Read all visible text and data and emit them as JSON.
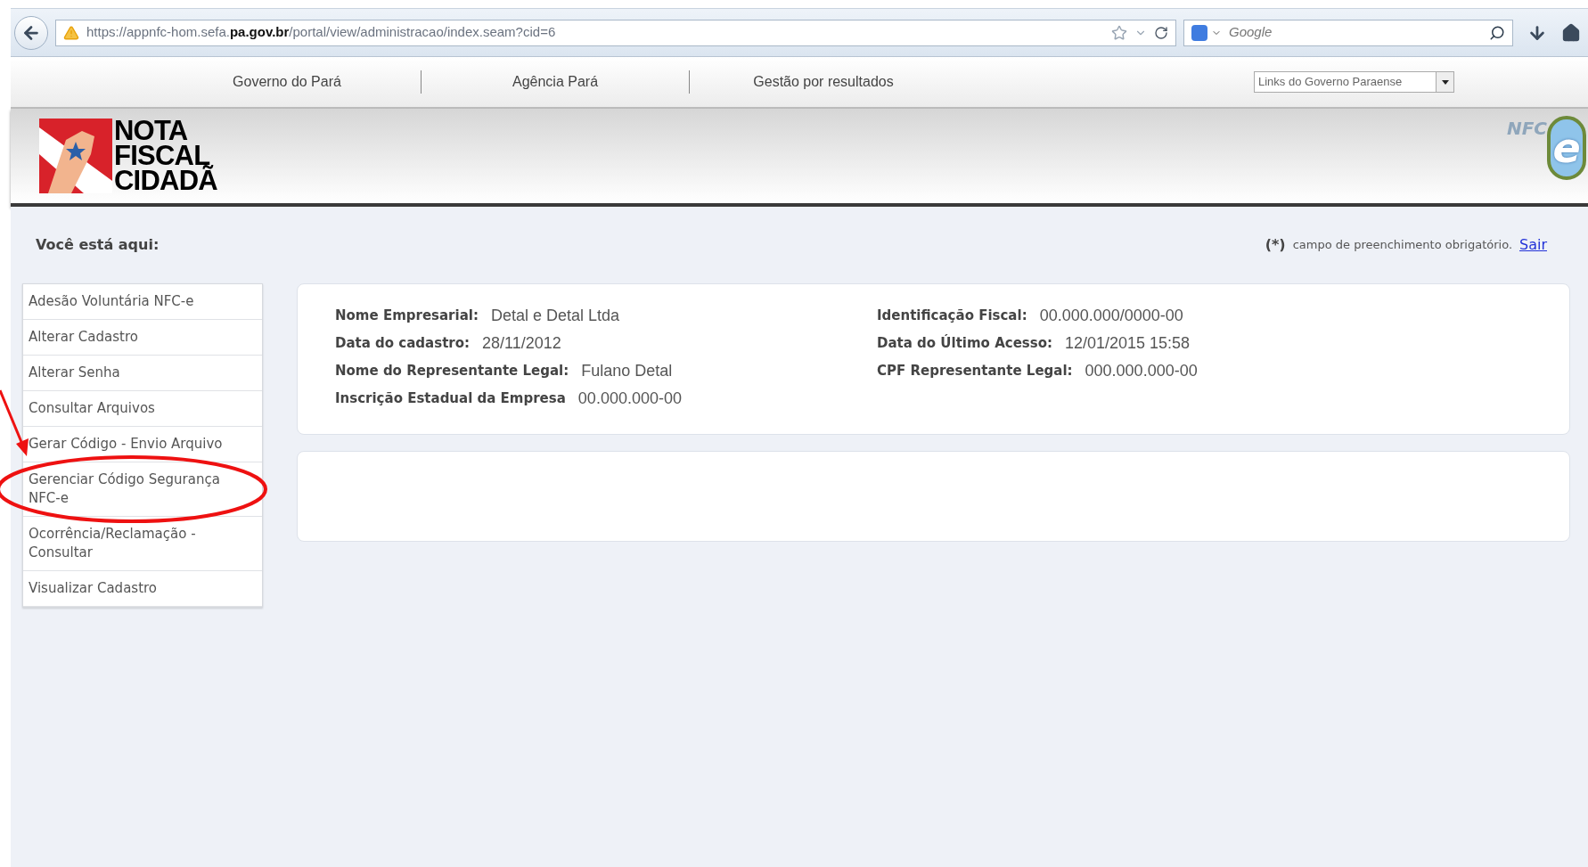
{
  "browser": {
    "url": "https://appnfc-hom.sefa.**pa.gov.br**/portal/view/administracao/index.seam?cid=6",
    "search": {
      "placeholder": "Google"
    }
  },
  "top_nav": {
    "links": [
      "Governo do Pará",
      "Agência Pará",
      "Gestão por resultados"
    ],
    "select": "Links do Governo Paraense"
  },
  "header": {
    "logo": [
      "NOTA",
      "FISCAL",
      "CIDADÃ"
    ],
    "badge": {
      "prefix": "NFC",
      "letter": "e"
    }
  },
  "breadcrumb": "Você está aqui:",
  "required_note": {
    "mark": "(*)",
    "text": "campo de preenchimento obrigatório.",
    "link": "Sair"
  },
  "sidebar": {
    "items": [
      {
        "label": "Adesão Voluntária NFC-e"
      },
      {
        "label": "Alterar Cadastro"
      },
      {
        "label": "Alterar Senha"
      },
      {
        "label": "Consultar Arquivos"
      },
      {
        "label": "Gerar Código - Envio Arquivo"
      },
      {
        "label": "Gerenciar Código Segurança NFC-e"
      },
      {
        "label": "Ocorrência/Reclamação - Consultar"
      },
      {
        "label": "Visualizar Cadastro"
      }
    ]
  },
  "info": {
    "columns": [
      [
        {
          "label": "Nome Empresarial:",
          "value": "Detal e Detal Ltda"
        },
        {
          "label": "Data do cadastro:",
          "value": "28/11/2012"
        },
        {
          "label": "Nome do Representante Legal:",
          "value": "Fulano Detal"
        },
        {
          "label": "Inscrição Estadual da Empresa",
          "value": "00.000.000-00"
        }
      ],
      [
        {
          "label": "Identificação Fiscal:",
          "value": "00.000.000/0000-00"
        },
        {
          "label": "Data do Último Acesso:",
          "value": "12/01/2015 15:58"
        },
        {
          "label": "CPF Representante Legal:",
          "value": "000.000.000-00"
        }
      ]
    ]
  }
}
